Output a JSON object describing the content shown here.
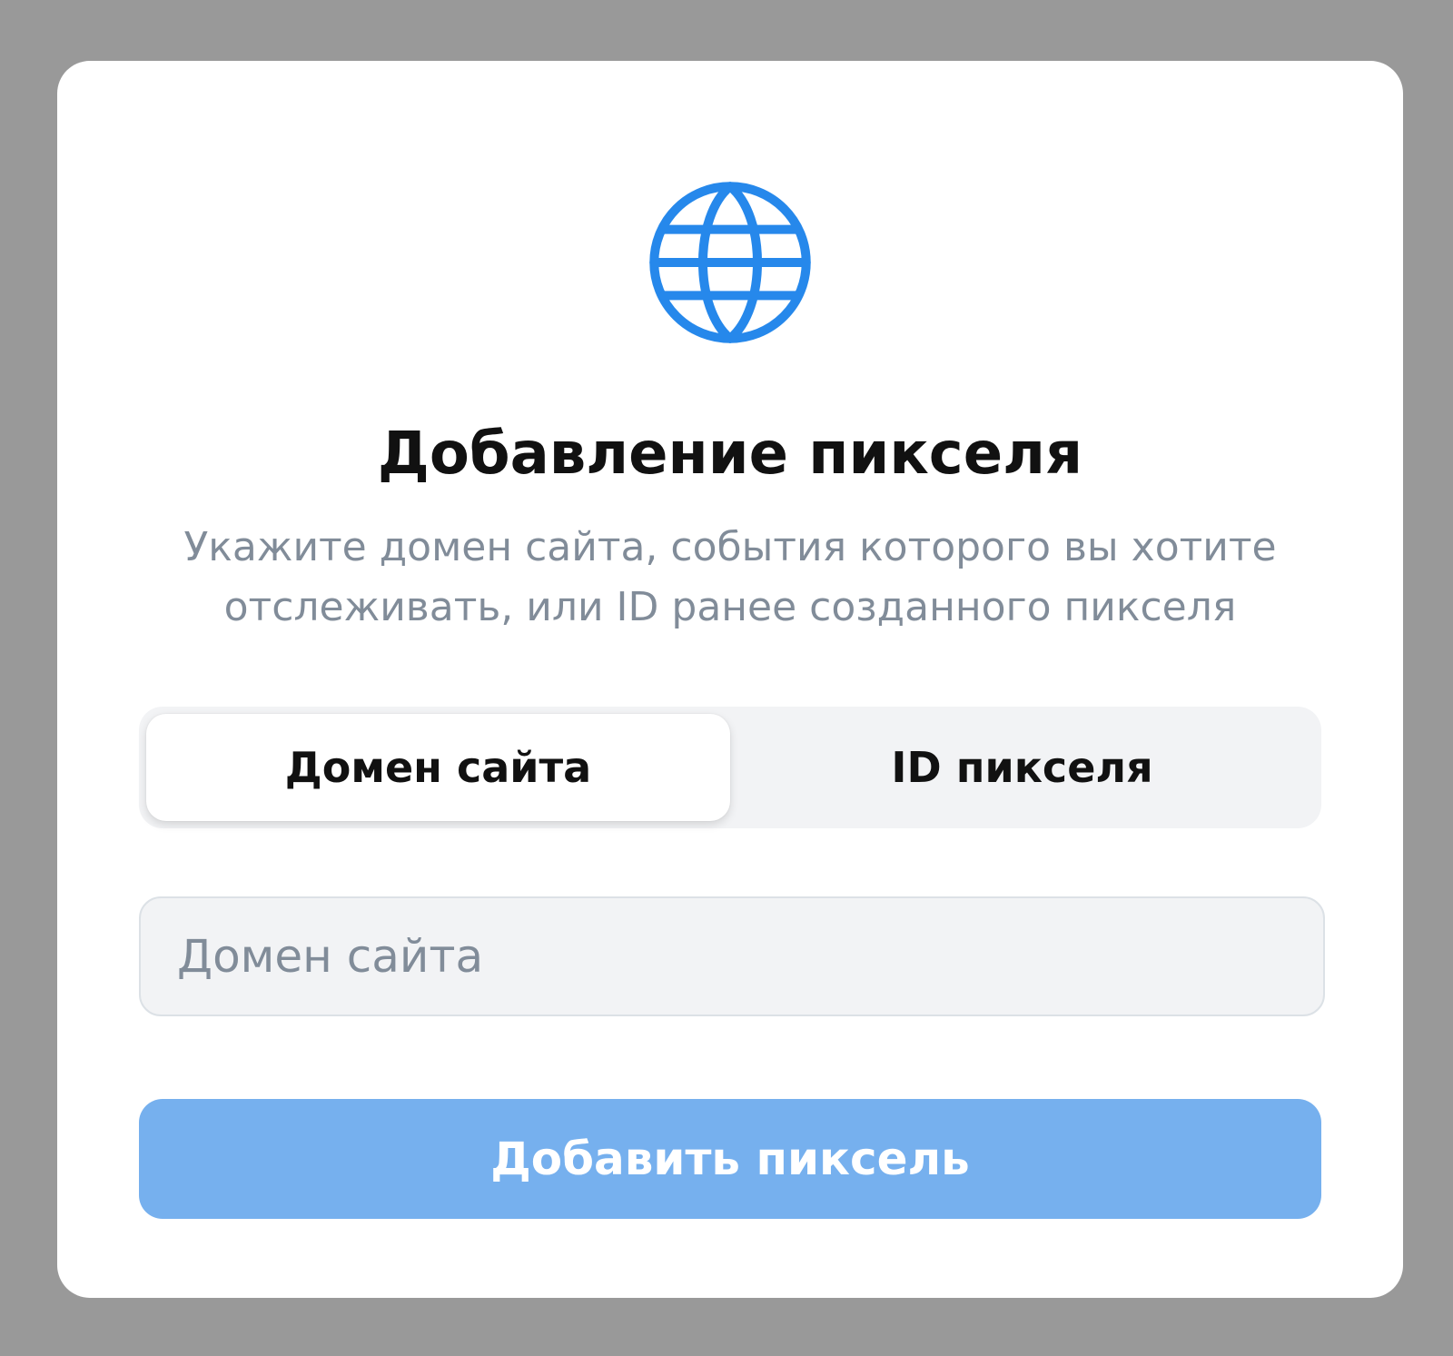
{
  "modal": {
    "icon": "globe-icon",
    "title": "Добавление пикселя",
    "subtitle": "Укажите домен сайта, события которого вы хотите отслеживать, или ID ранее созданного пикселя",
    "tabs": [
      {
        "label": "Домен сайта",
        "selected": true
      },
      {
        "label": "ID пикселя",
        "selected": false
      }
    ],
    "input": {
      "placeholder": "Домен сайта",
      "value": ""
    },
    "submit_label": "Добавить пиксель"
  },
  "colors": {
    "overlay": "#999999",
    "accent": "#2688eb",
    "button_disabled": "#76b0ee",
    "muted_text": "#818c99",
    "segment_bg": "#f2f3f5"
  }
}
